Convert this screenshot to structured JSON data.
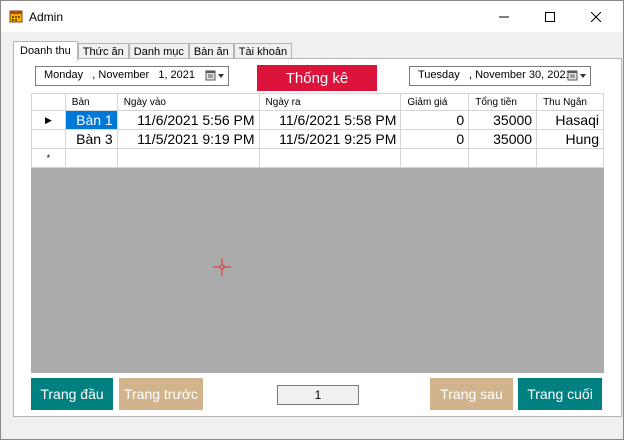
{
  "window": {
    "title": "Admin"
  },
  "tabs": [
    {
      "label": "Doanh thu",
      "active": true
    },
    {
      "label": "Thức ăn",
      "active": false
    },
    {
      "label": "Danh mục",
      "active": false
    },
    {
      "label": "Bàn ăn",
      "active": false
    },
    {
      "label": "Tài khoản",
      "active": false
    }
  ],
  "filters": {
    "from_date": "Monday   , November   1, 2021",
    "to_date": "Tuesday   , November 30, 2021",
    "stat_button": "Thống kê"
  },
  "grid": {
    "columns": [
      "Bàn",
      "Ngày vào",
      "Ngày ra",
      "Giảm giá",
      "Tổng tiền",
      "Thu Ngân"
    ],
    "rows": [
      {
        "marker": "▶",
        "cells": [
          "Bàn 1",
          "11/6/2021 5:56 PM",
          "11/6/2021 5:58 PM",
          "0",
          "35000",
          "Hasaqi"
        ]
      },
      {
        "marker": "",
        "cells": [
          "Bàn 3",
          "11/5/2021 9:19 PM",
          "11/5/2021 9:25 PM",
          "0",
          "35000",
          "Hung"
        ]
      }
    ],
    "new_row_marker": "*"
  },
  "pagination": {
    "first": "Trang đầu",
    "prev": "Trang trước",
    "page": "1",
    "next": "Trang sau",
    "last": "Trang cuối"
  },
  "colors": {
    "stat_button": "#dc143c",
    "teal": "#008080",
    "tan": "#d2b48c",
    "selection": "#0078d7"
  }
}
